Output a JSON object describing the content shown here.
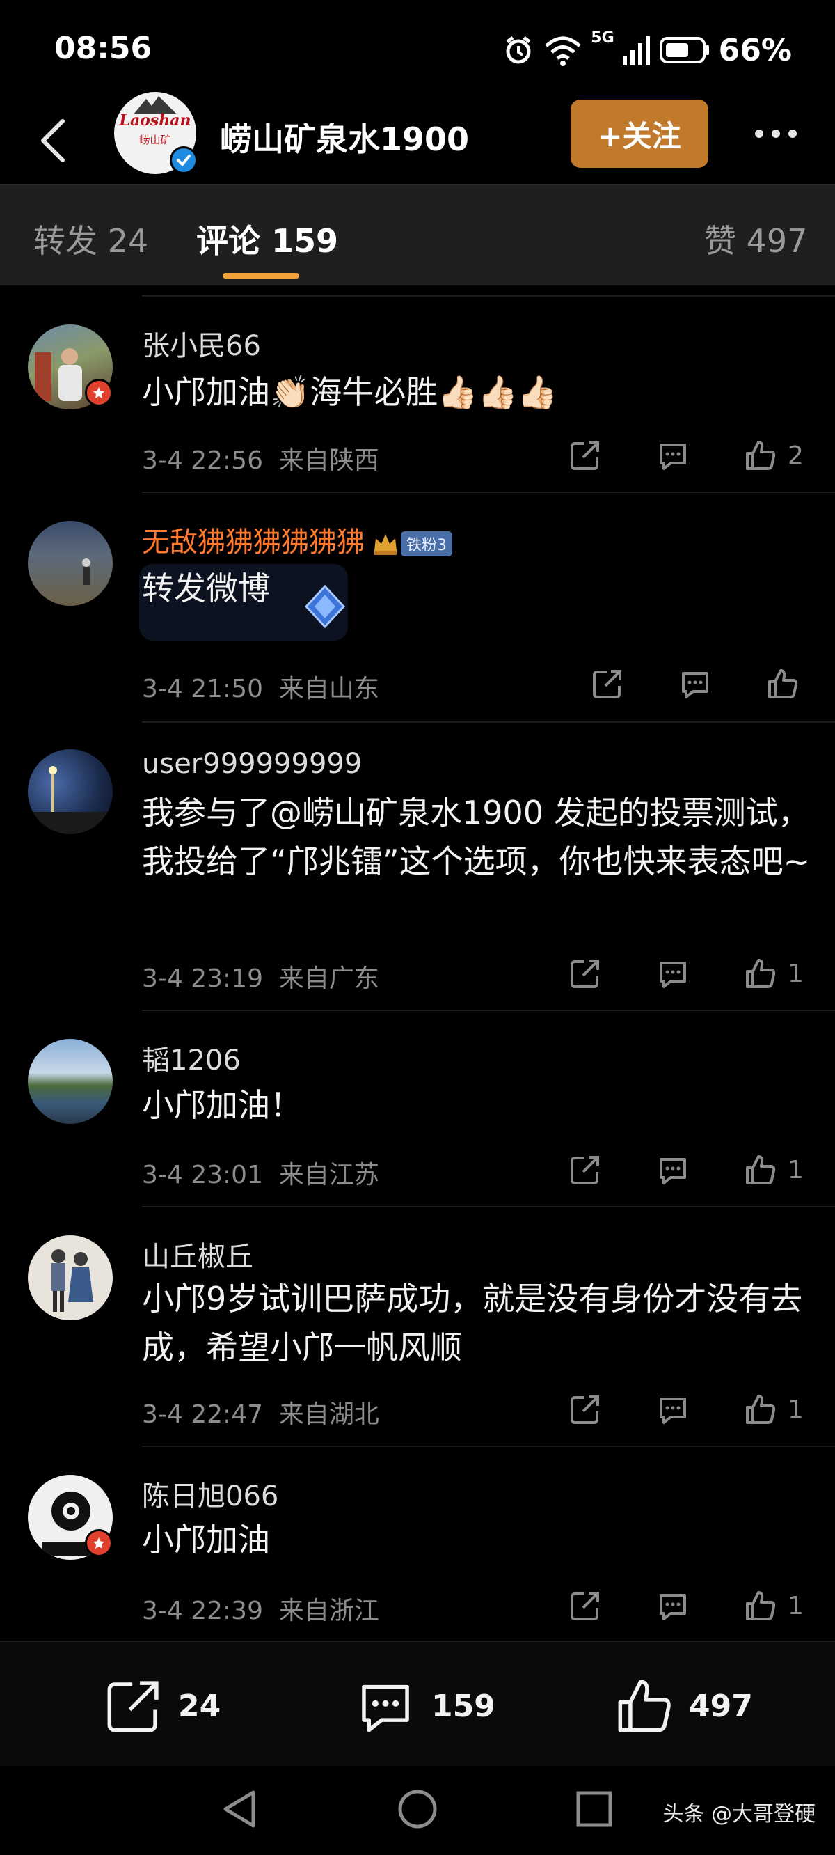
{
  "status_bar": {
    "time": "08:56",
    "network": "5G",
    "battery": "66%"
  },
  "header": {
    "account_name": "崂山矿泉水1900",
    "logo_text": "Laoshan",
    "logo_subtext": "崂山矿",
    "follow_label": "+关注"
  },
  "tabs": [
    {
      "label": "转发 24"
    },
    {
      "label": "评论 159"
    },
    {
      "label": "赞 497"
    }
  ],
  "comments": [
    {
      "username": "张小民66",
      "text": "小邝加油👏🏻海牛必胜👍🏻👍🏻👍🏻",
      "time": "3-4 22:56",
      "location": "来自陕西",
      "likes": "2"
    },
    {
      "username": "无敌狒狒狒狒狒狒",
      "fan_badge": "铁粉3",
      "text": "转发微博",
      "time": "3-4 21:50",
      "location": "来自山东",
      "likes": ""
    },
    {
      "username": "user999999999",
      "text": "我参与了@崂山矿泉水1900 发起的投票测试，我投给了“邝兆镭”这个选项，你也快来表态吧~",
      "time": "3-4 23:19",
      "location": "来自广东",
      "likes": "1"
    },
    {
      "username": "韬1206",
      "text": "小邝加油！",
      "time": "3-4 23:01",
      "location": "来自江苏",
      "likes": "1"
    },
    {
      "username": "山丘椒丘",
      "text": "小邝9岁试训巴萨成功，就是没有身份才没有去成，希望小邝一帆风顺",
      "time": "3-4 22:47",
      "location": "来自湖北",
      "likes": "1"
    },
    {
      "username": "陈日旭066",
      "text": "小邝加油",
      "time": "3-4 22:39",
      "location": "来自浙江",
      "likes": "1"
    }
  ],
  "bottom_bar": {
    "reposts": "24",
    "comments": "159",
    "likes": "497"
  },
  "watermark": "头条 @大哥登硬",
  "colors": {
    "accent": "#c17a2c",
    "tab_indicator": "#f0a13a",
    "vip_name": "#ff7a2e",
    "verified": "#1e8be0"
  }
}
